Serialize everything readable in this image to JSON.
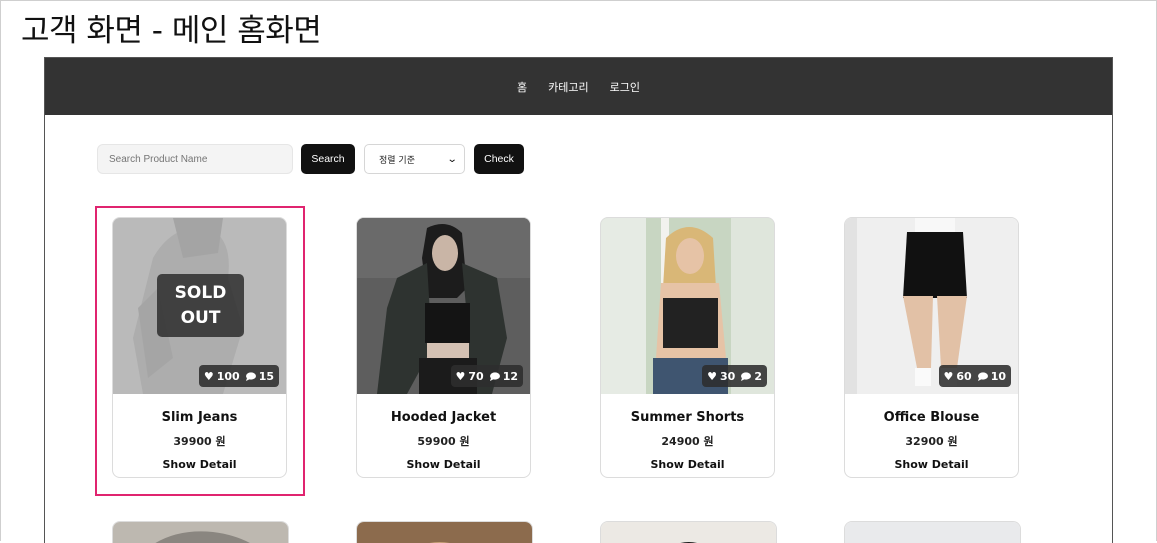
{
  "doc_title": "고객 화면 - 메인 홈화면",
  "nav": {
    "links": [
      "홈",
      "카테고리",
      "로그인"
    ]
  },
  "toolbar": {
    "search_placeholder": "Search Product Name",
    "search_label": "Search",
    "sort_selected": "정렬 기준",
    "check_label": "Check"
  },
  "products": [
    {
      "name": "Slim Jeans",
      "price": "39900 원",
      "likes": "100",
      "comments": "15",
      "sold_out": true,
      "sold_out_label": "SOLD OUT",
      "detail_label": "Show Detail"
    },
    {
      "name": "Hooded Jacket",
      "price": "59900 원",
      "likes": "70",
      "comments": "12",
      "sold_out": false,
      "detail_label": "Show Detail"
    },
    {
      "name": "Summer Shorts",
      "price": "24900 원",
      "likes": "30",
      "comments": "2",
      "sold_out": false,
      "detail_label": "Show Detail"
    },
    {
      "name": "Office Blouse",
      "price": "32900 원",
      "likes": "60",
      "comments": "10",
      "sold_out": false,
      "detail_label": "Show Detail"
    }
  ],
  "colors": {
    "navbar": "#333333",
    "highlight": "#e0246f",
    "button": "#111111"
  },
  "icons": [
    "heart-icon",
    "comment-icon",
    "caret-down-icon"
  ]
}
